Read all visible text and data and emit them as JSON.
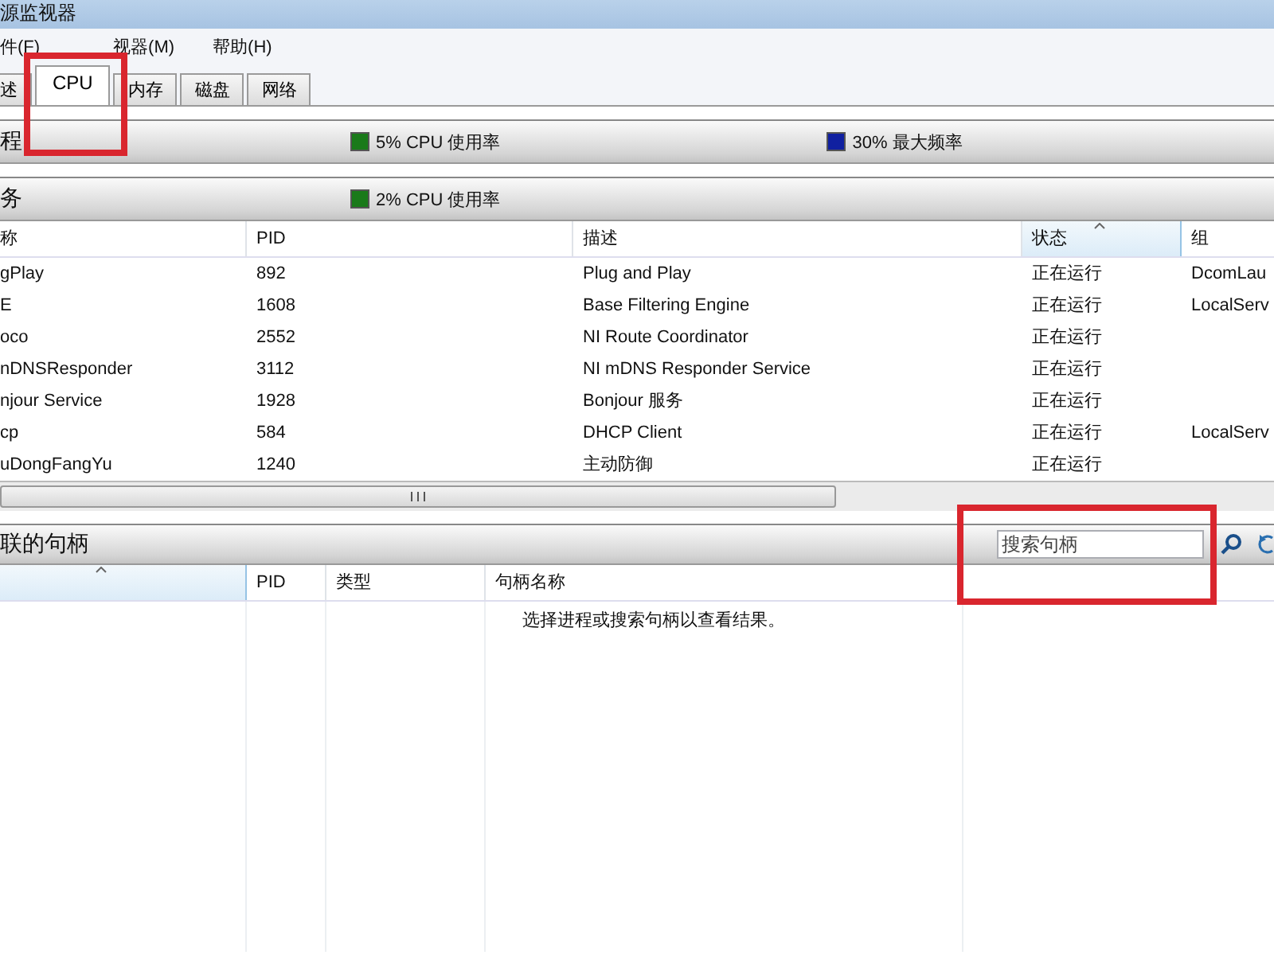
{
  "window": {
    "title": "源监视器"
  },
  "menu": [
    "件(F)",
    "视器(M)",
    "帮助(H)"
  ],
  "tabs": [
    {
      "label": "述",
      "selected": false
    },
    {
      "label": "CPU",
      "selected": true
    },
    {
      "label": "内存",
      "selected": false
    },
    {
      "label": "磁盘",
      "selected": false
    },
    {
      "label": "网络",
      "selected": false
    }
  ],
  "processes_header": {
    "title": "程",
    "stats": [
      {
        "text": "5% CPU 使用率",
        "color": "#1a7a1a"
      },
      {
        "text": "30% 最大频率",
        "color": "#1020a0"
      }
    ]
  },
  "services": {
    "title": "务",
    "stats": [
      {
        "text": "2% CPU 使用率",
        "color": "#1a7a1a"
      }
    ],
    "columns": [
      {
        "label": "称",
        "sorted": false
      },
      {
        "label": "PID",
        "sorted": false
      },
      {
        "label": "描述",
        "sorted": false
      },
      {
        "label": "状态",
        "sorted": true
      },
      {
        "label": "组",
        "sorted": false
      }
    ],
    "rows": [
      [
        "gPlay",
        "892",
        "Plug and Play",
        "正在运行",
        "DcomLau"
      ],
      [
        "E",
        "1608",
        "Base Filtering Engine",
        "正在运行",
        "LocalServ"
      ],
      [
        "oco",
        "2552",
        "NI Route Coordinator",
        "正在运行",
        ""
      ],
      [
        "nDNSResponder",
        "3112",
        "NI mDNS Responder Service",
        "正在运行",
        ""
      ],
      [
        "njour Service",
        "1928",
        "Bonjour 服务",
        "正在运行",
        ""
      ],
      [
        "cp",
        "584",
        "DHCP Client",
        "正在运行",
        "LocalServ"
      ],
      [
        "uDongFangYu",
        "1240",
        "主动防御",
        "正在运行",
        ""
      ]
    ]
  },
  "handles": {
    "title": "联的句柄",
    "search": {
      "placeholder": "搜索句柄"
    },
    "columns": [
      {
        "sorted": true
      },
      {
        "label": "PID",
        "sorted": false
      },
      {
        "label": "类型",
        "sorted": false
      },
      {
        "label": "句柄名称",
        "sorted": false
      }
    ],
    "message": "选择进程或搜索句柄以查看结果。"
  }
}
